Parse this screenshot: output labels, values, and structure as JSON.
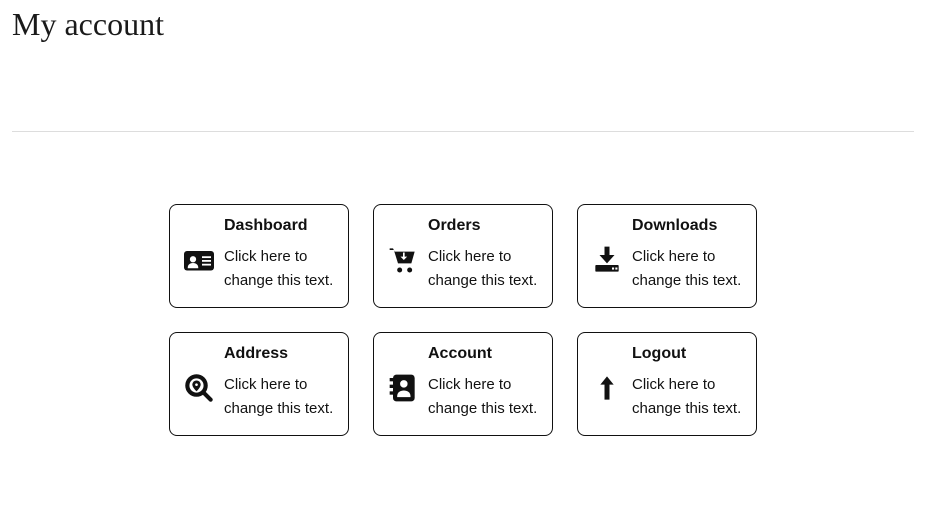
{
  "page": {
    "title": "My account"
  },
  "cards": [
    {
      "title": "Dashboard",
      "desc": "Click here to change this text.",
      "icon": "id-card"
    },
    {
      "title": "Orders",
      "desc": "Click here to change this text.",
      "icon": "cart-download"
    },
    {
      "title": "Downloads",
      "desc": "Click here to change this text.",
      "icon": "download"
    },
    {
      "title": "Address",
      "desc": "Click here to change this text.",
      "icon": "search-location"
    },
    {
      "title": "Account",
      "desc": "Click here to change this text.",
      "icon": "address-book"
    },
    {
      "title": "Logout",
      "desc": "Click here to change this text.",
      "icon": "arrow-up"
    }
  ]
}
